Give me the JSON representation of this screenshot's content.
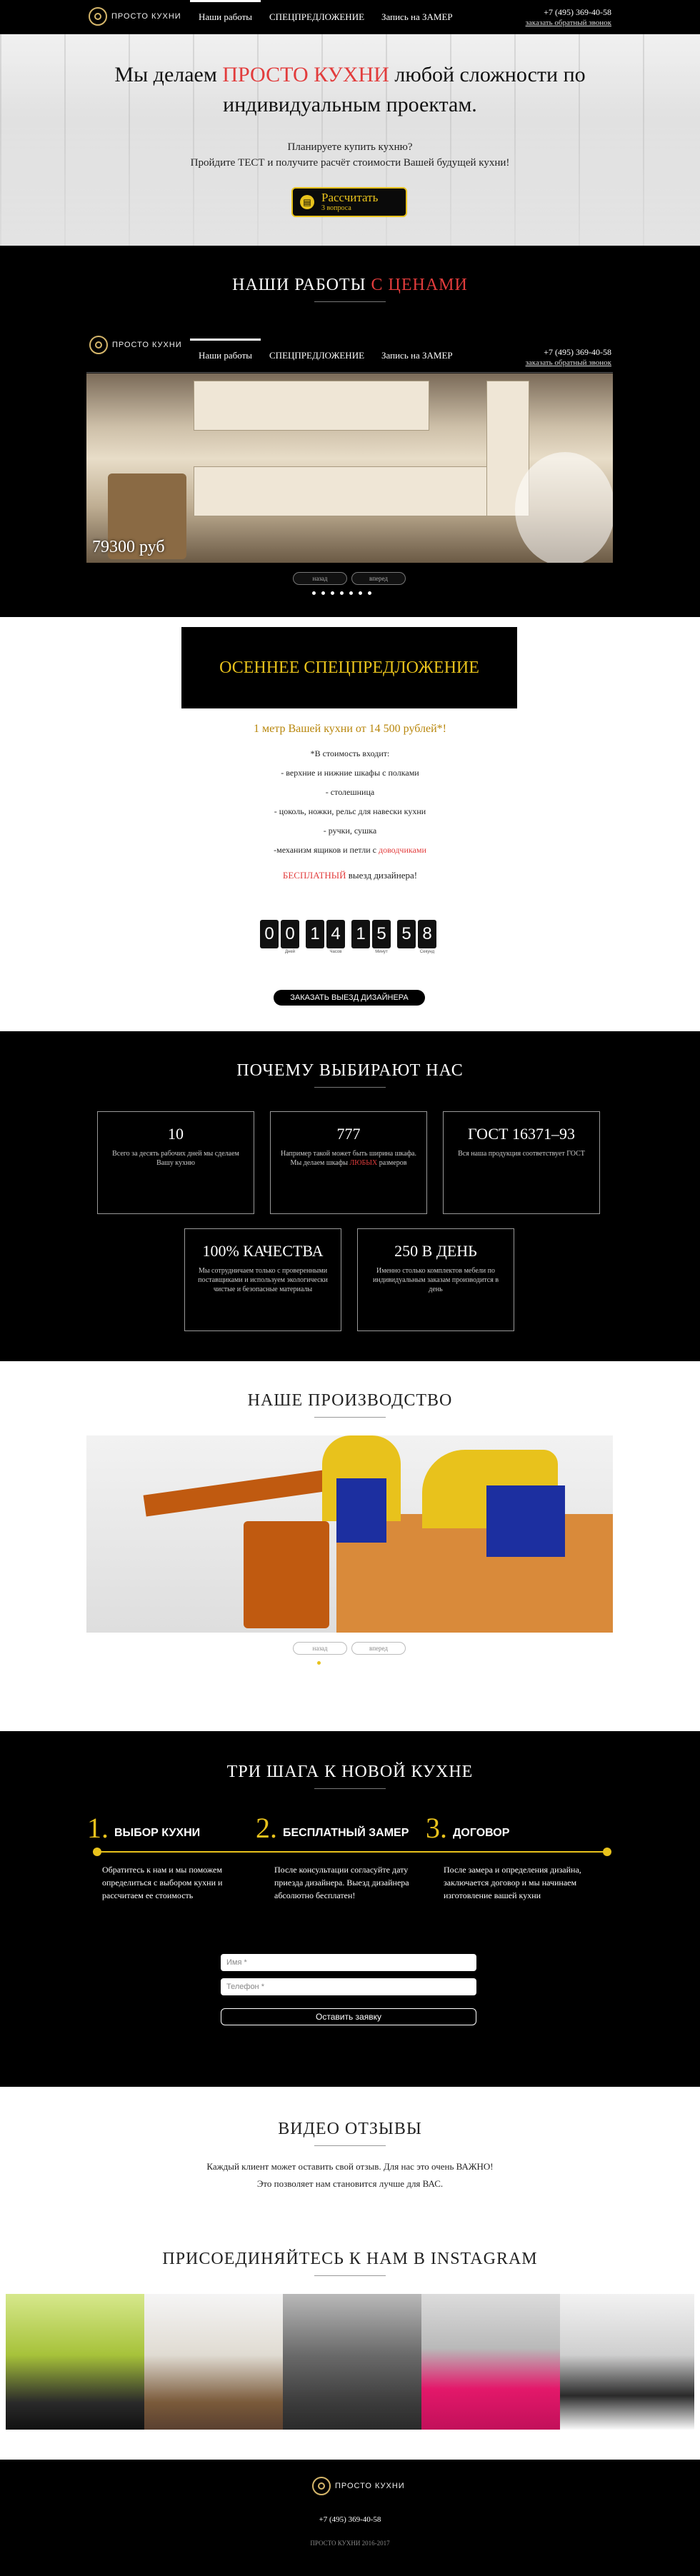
{
  "header": {
    "logo_text": "ПРОСТО КУХНИ",
    "nav": [
      "Наши работы",
      "СПЕЦПРЕДЛОЖЕНИЕ",
      "Запись на ЗАМЕР"
    ],
    "phone": "+7 (495) 369-40-58",
    "callback": "заказать обратный звонок"
  },
  "hero": {
    "title_before": "Мы делаем ",
    "title_accent": "ПРОСТО КУХНИ",
    "title_after": " любой сложности по индивидуальным проектам.",
    "question": "Планируете купить кухню?",
    "cta_text": "Пройдите ТЕСТ и получите расчёт стоимости Вашей будущей кухни!",
    "button_label": "Рассчитать",
    "button_sub": "3 вопроса",
    "accent": "#e23c3c",
    "gold": "#e8c21c"
  },
  "works": {
    "title_before": "НАШИ РАБОТЫ ",
    "title_accent": "С ЦЕНАМИ",
    "price": "79300 руб",
    "prev": "назад",
    "next": "вперед",
    "slides_total": 7,
    "active_slide": 1
  },
  "offer": {
    "box_title": "ОСЕННЕЕ СПЕЦПРЕДЛОЖЕНИЕ",
    "headline": "1 метр Вашей кухни от 14 500 рублей*!",
    "includes_intro": "*В стоимость входит:",
    "includes": [
      "- верхние и нижние шкафы с полками",
      "- столешница",
      "- цоколь, ножки, рельс для навески кухни",
      "- ручки, сушка"
    ],
    "last_item_before": "-механизм ящиков и петли с ",
    "last_item_accent": "доводчиками",
    "free_accent": "БЕСПЛАТНЫЙ",
    "free_rest": " выезд дизайнера!",
    "timer": {
      "digits": [
        "0",
        "0",
        "1",
        "4",
        "1",
        "5",
        "5",
        "8"
      ],
      "labels": [
        "Дней",
        "Часов",
        "Минут",
        "Секунд"
      ]
    },
    "order_button": "ЗАКАЗАТЬ ВЫЕЗД ДИЗАЙНЕРА"
  },
  "why": {
    "title": "ПОЧЕМУ ВЫБИРАЮТ НАС",
    "cards": [
      {
        "title": "10",
        "text": "Всего за десять рабочих дней мы сделаем Вашу кухню"
      },
      {
        "title": "777",
        "text_before": "Например такой может быть ширина шкафа. Мы делаем шкафы ",
        "text_accent": "ЛЮБЫХ",
        "text_after": " размеров"
      },
      {
        "title": "ГОСТ 16371–93",
        "text": "Вся наша продукция соответствует ГОСТ"
      },
      {
        "title": "100% КАЧЕСТВА",
        "text": "Мы сотрудничаем только с проверенными поставщиками и используем экологически чистые и безопасные материалы"
      },
      {
        "title": "250 В ДЕНЬ",
        "text": "Именно столько комплектов мебели по индивидуальным заказам производится в день"
      }
    ]
  },
  "production": {
    "title": "НАШЕ ПРОИЗВОДСТВО",
    "prev": "назад",
    "next": "вперед",
    "slides_total": 6,
    "active_slide": 1
  },
  "steps": {
    "title": "ТРИ ШАГА К НОВОЙ КУХНЕ",
    "items": [
      {
        "num": "1.",
        "label": "ВЫБОР КУХНИ",
        "text": "Обратитесь к нам и мы поможем определиться с выбором кухни и рассчитаем ее стоимость"
      },
      {
        "num": "2.",
        "label": "БЕСПЛАТНЫЙ ЗАМЕР",
        "text": "После консультации согласуйте дату приезда дизайнера. Выезд дизайнера абсолютно бесплатен!"
      },
      {
        "num": "3.",
        "label": "ДОГОВОР",
        "text": "После замера и определения дизайна, заключается договор и мы начинаем изготовление вашей кухни"
      }
    ],
    "name_placeholder": "Имя *",
    "phone_placeholder": "Телефон *",
    "submit": "Оставить заявку"
  },
  "video": {
    "title": "ВИДЕО ОТЗЫВЫ",
    "line1": "Каждый клиент может оставить свой отзыв. Для нас это очень ВАЖНО!",
    "line2": "Это позволяет нам становится лучше для ВАС."
  },
  "insta": {
    "title": "ПРИСОЕДИНЯЙТЕСЬ К НАМ В INSTAGRAM"
  },
  "footer": {
    "logo_text": "ПРОСТО КУХНИ",
    "phone": "+7 (495) 369-40-58",
    "copyright": "ПРОСТО КУХНИ 2016-2017"
  }
}
